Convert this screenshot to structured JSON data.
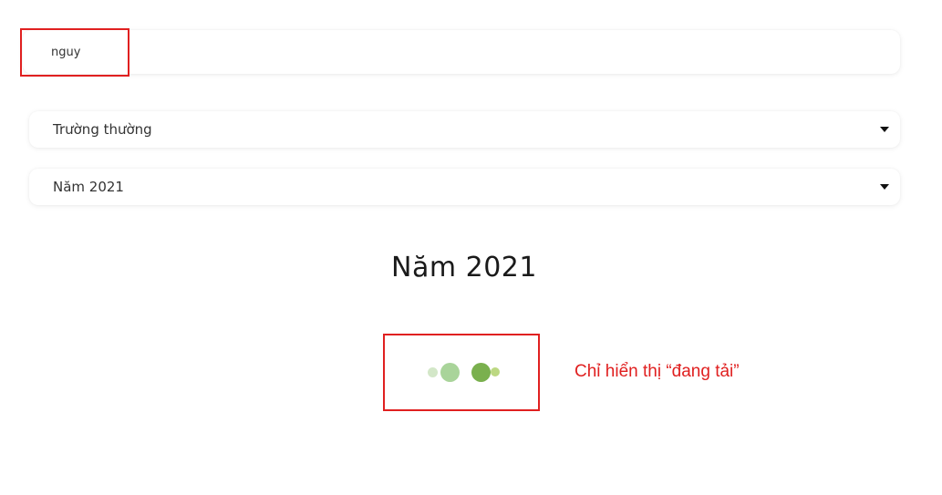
{
  "search": {
    "value": "nguy",
    "placeholder": ""
  },
  "filters": {
    "school_type": {
      "selected": "Trường thường",
      "icon": "caret-down-icon"
    },
    "year": {
      "selected": "Năm 2021",
      "icon": "caret-down-icon"
    }
  },
  "main": {
    "heading": "Năm 2021"
  },
  "loader": {
    "dot_colors": [
      "#d3e7c8",
      "#a9d49a",
      "#7ab04e",
      "#bcd882"
    ]
  },
  "annotation": {
    "note": "Chỉ hiển thị “đang tải”",
    "color": "#e02020"
  }
}
